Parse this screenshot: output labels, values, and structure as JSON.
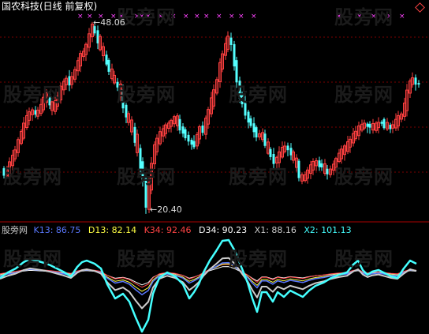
{
  "colors": {
    "background": "#000000",
    "up_candle": "#ff4040",
    "down_candle": "#54ffff",
    "star_marker": "#ff44ff",
    "grid": "#7a0000",
    "label_gray": "#c8c8c8",
    "K13": "#5a78ff",
    "D13": "#ffff44",
    "K34": "#ff4444",
    "D34": "#ffffff",
    "X1": "#cccccc",
    "X2": "#44ffff"
  },
  "top_panel": {
    "title": "国农科技(日线 前复权)",
    "high_annotation": "48.06",
    "low_annotation": "20.40",
    "corner_icon": "diamond-icon"
  },
  "bottom_panel": {
    "indicator_name": "股旁网",
    "labels": {
      "k13": "K13: 86.75",
      "d13": "D13: 82.14",
      "k34": "K34: 92.46",
      "d34": "D34: 90.23",
      "x1": "X1: 88.16",
      "x2": "X2: 101.13"
    }
  },
  "watermark": "股旁网"
}
